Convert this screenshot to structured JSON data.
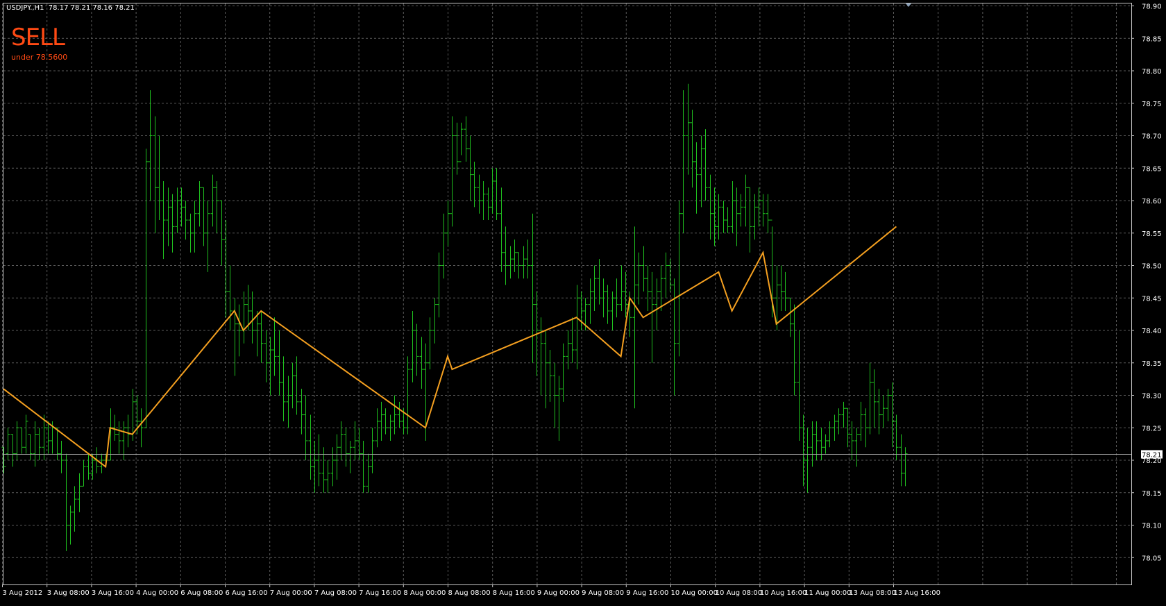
{
  "header": {
    "symbol_info": "USDJPY.,H1  78.17 78.21 78.16 78.21"
  },
  "signal": {
    "label": "SELL",
    "sublabel": "under 78.5600",
    "color": "#ff4a14"
  },
  "colors": {
    "background": "#000000",
    "grid": "#5a5a5a",
    "frame": "#c8c8c8",
    "bars": "#1fc21f",
    "zigzag": "#f5a020",
    "price_line": "#a0a0a0",
    "axis_text": "#ffffff",
    "current_price_bg": "#ffffff",
    "current_price_text": "#000000"
  },
  "chart_data": {
    "type": "ohlc",
    "timeframe": "H1",
    "symbol": "USDJPY.",
    "ylim": [
      78.0,
      78.9
    ],
    "y_ticks": [
      "78.90",
      "78.85",
      "78.80",
      "78.75",
      "78.70",
      "78.65",
      "78.60",
      "78.55",
      "78.50",
      "78.45",
      "78.40",
      "78.35",
      "78.30",
      "78.25",
      "78.20",
      "78.15",
      "78.10",
      "78.05"
    ],
    "x_ticks": [
      "3 Aug 2012",
      "3 Aug 08:00",
      "3 Aug 16:00",
      "4 Aug 00:00",
      "6 Aug 08:00",
      "6 Aug 16:00",
      "7 Aug 00:00",
      "7 Aug 08:00",
      "7 Aug 16:00",
      "8 Aug 00:00",
      "8 Aug 08:00",
      "8 Aug 16:00",
      "9 Aug 00:00",
      "9 Aug 08:00",
      "9 Aug 16:00",
      "10 Aug 00:00",
      "10 Aug 08:00",
      "10 Aug 16:00",
      "11 Aug 00:00",
      "13 Aug 08:00",
      "13 Aug 16:00"
    ],
    "current_price": "78.21",
    "zigzag": [
      {
        "bar": 0,
        "price": 78.31
      },
      {
        "bar": 23,
        "price": 78.19
      },
      {
        "bar": 24,
        "price": 78.25
      },
      {
        "bar": 29,
        "price": 78.24
      },
      {
        "bar": 52,
        "price": 78.43
      },
      {
        "bar": 54,
        "price": 78.4
      },
      {
        "bar": 58,
        "price": 78.43
      },
      {
        "bar": 95,
        "price": 78.25
      },
      {
        "bar": 100,
        "price": 78.36
      },
      {
        "bar": 101,
        "price": 78.34
      },
      {
        "bar": 129,
        "price": 78.42
      },
      {
        "bar": 139,
        "price": 78.36
      },
      {
        "bar": 141,
        "price": 78.45
      },
      {
        "bar": 144,
        "price": 78.42
      },
      {
        "bar": 161,
        "price": 78.49
      },
      {
        "bar": 164,
        "price": 78.43
      },
      {
        "bar": 171,
        "price": 78.52
      },
      {
        "bar": 174,
        "price": 78.41
      },
      {
        "bar": 201,
        "price": 78.56
      }
    ],
    "bars": [
      [
        78.22,
        78.18,
        78.22,
        78.19
      ],
      [
        78.25,
        78.2,
        78.21,
        78.24
      ],
      [
        78.24,
        78.19,
        78.24,
        78.21
      ],
      [
        78.26,
        78.2,
        78.21,
        78.25
      ],
      [
        78.25,
        78.21,
        78.25,
        78.22
      ],
      [
        78.27,
        78.21,
        78.22,
        78.26
      ],
      [
        78.24,
        78.2,
        78.24,
        78.21
      ],
      [
        78.26,
        78.19,
        78.21,
        78.24
      ],
      [
        78.25,
        78.2,
        78.24,
        78.22
      ],
      [
        78.27,
        78.2,
        78.22,
        78.25
      ],
      [
        78.26,
        78.21,
        78.25,
        78.23
      ],
      [
        78.26,
        78.21,
        78.23,
        78.25
      ],
      [
        78.25,
        78.2,
        78.25,
        78.21
      ],
      [
        78.23,
        78.18,
        78.21,
        78.2
      ],
      [
        78.21,
        78.06,
        78.2,
        78.1
      ],
      [
        78.13,
        78.07,
        78.1,
        78.12
      ],
      [
        78.16,
        78.09,
        78.12,
        78.14
      ],
      [
        78.18,
        78.12,
        78.14,
        78.16
      ],
      [
        78.2,
        78.16,
        78.16,
        78.19
      ],
      [
        78.21,
        78.17,
        78.19,
        78.18
      ],
      [
        78.21,
        78.17,
        78.18,
        78.2
      ],
      [
        78.22,
        78.18,
        78.2,
        78.19
      ],
      [
        78.21,
        78.18,
        78.19,
        78.2
      ],
      [
        78.21,
        78.19,
        78.2,
        78.2
      ],
      [
        78.28,
        78.2,
        78.2,
        78.25
      ],
      [
        78.27,
        78.23,
        78.25,
        78.24
      ],
      [
        78.26,
        78.21,
        78.24,
        78.23
      ],
      [
        78.26,
        78.2,
        78.23,
        78.25
      ],
      [
        78.27,
        78.22,
        78.25,
        78.24
      ],
      [
        78.31,
        78.23,
        78.24,
        78.29
      ],
      [
        78.3,
        78.24,
        78.29,
        78.26
      ],
      [
        78.28,
        78.22,
        78.26,
        78.25
      ],
      [
        78.68,
        78.25,
        78.25,
        78.66
      ],
      [
        78.77,
        78.6,
        78.66,
        78.7
      ],
      [
        78.73,
        78.55,
        78.7,
        78.62
      ],
      [
        78.7,
        78.57,
        78.62,
        78.6
      ],
      [
        78.63,
        78.51,
        78.6,
        78.57
      ],
      [
        78.62,
        78.53,
        78.57,
        78.59
      ],
      [
        78.61,
        78.52,
        78.59,
        78.56
      ],
      [
        78.62,
        78.55,
        78.56,
        78.6
      ],
      [
        78.62,
        78.56,
        78.6,
        78.59
      ],
      [
        78.6,
        78.54,
        78.59,
        78.57
      ],
      [
        78.58,
        78.52,
        78.57,
        78.55
      ],
      [
        78.6,
        78.52,
        78.55,
        78.58
      ],
      [
        78.63,
        78.56,
        78.58,
        78.62
      ],
      [
        78.62,
        78.53,
        78.62,
        78.55
      ],
      [
        78.6,
        78.49,
        78.55,
        78.58
      ],
      [
        78.64,
        78.56,
        78.58,
        78.62
      ],
      [
        78.63,
        78.55,
        78.62,
        78.6
      ],
      [
        78.6,
        78.5,
        78.6,
        78.54
      ],
      [
        78.57,
        78.42,
        78.54,
        78.46
      ],
      [
        78.5,
        78.4,
        78.46,
        78.43
      ],
      [
        78.45,
        78.33,
        78.43,
        78.41
      ],
      [
        78.44,
        78.36,
        78.41,
        78.4
      ],
      [
        78.46,
        78.38,
        78.4,
        78.44
      ],
      [
        78.47,
        78.4,
        78.44,
        78.43
      ],
      [
        78.46,
        78.38,
        78.43,
        78.4
      ],
      [
        78.43,
        78.36,
        78.4,
        78.41
      ],
      [
        78.43,
        78.35,
        78.41,
        78.38
      ],
      [
        78.4,
        78.32,
        78.38,
        78.35
      ],
      [
        78.39,
        78.3,
        78.35,
        78.37
      ],
      [
        78.42,
        78.33,
        78.37,
        78.36
      ],
      [
        78.4,
        78.3,
        78.36,
        78.32
      ],
      [
        78.36,
        78.26,
        78.32,
        78.29
      ],
      [
        78.33,
        78.25,
        78.29,
        78.3
      ],
      [
        78.35,
        78.28,
        78.3,
        78.33
      ],
      [
        78.36,
        78.27,
        78.33,
        78.29
      ],
      [
        78.31,
        78.24,
        78.29,
        78.27
      ],
      [
        78.3,
        78.2,
        78.27,
        78.23
      ],
      [
        78.27,
        78.17,
        78.23,
        78.19
      ],
      [
        78.23,
        78.15,
        78.19,
        78.2
      ],
      [
        78.24,
        78.16,
        78.2,
        78.18
      ],
      [
        78.22,
        78.15,
        78.18,
        78.17
      ],
      [
        78.2,
        78.15,
        78.17,
        78.18
      ],
      [
        78.22,
        78.16,
        78.18,
        78.2
      ],
      [
        78.24,
        78.17,
        78.2,
        78.22
      ],
      [
        78.26,
        78.2,
        78.22,
        78.24
      ],
      [
        78.25,
        78.19,
        78.24,
        78.21
      ],
      [
        78.23,
        78.18,
        78.21,
        78.22
      ],
      [
        78.26,
        78.2,
        78.22,
        78.23
      ],
      [
        78.25,
        78.2,
        78.23,
        78.21
      ],
      [
        78.23,
        78.15,
        78.21,
        78.16
      ],
      [
        78.21,
        78.15,
        78.16,
        78.19
      ],
      [
        78.25,
        78.18,
        78.19,
        78.23
      ],
      [
        78.28,
        78.22,
        78.23,
        78.26
      ],
      [
        78.29,
        78.23,
        78.26,
        78.27
      ],
      [
        78.28,
        78.24,
        78.27,
        78.25
      ],
      [
        78.27,
        78.23,
        78.25,
        78.26
      ],
      [
        78.3,
        78.24,
        78.26,
        78.27
      ],
      [
        78.29,
        78.25,
        78.27,
        78.26
      ],
      [
        78.28,
        78.24,
        78.26,
        78.25
      ],
      [
        78.36,
        78.24,
        78.25,
        78.34
      ],
      [
        78.43,
        78.32,
        78.34,
        78.4
      ],
      [
        78.41,
        78.33,
        78.4,
        78.36
      ],
      [
        78.39,
        78.31,
        78.36,
        78.34
      ],
      [
        78.38,
        78.23,
        78.34,
        78.35
      ],
      [
        78.42,
        78.34,
        78.35,
        78.4
      ],
      [
        78.45,
        78.38,
        78.4,
        78.44
      ],
      [
        78.52,
        78.42,
        78.44,
        78.5
      ],
      [
        78.58,
        78.48,
        78.5,
        78.55
      ],
      [
        78.6,
        78.53,
        78.55,
        78.58
      ],
      [
        78.73,
        78.56,
        78.58,
        78.7
      ],
      [
        78.72,
        78.64,
        78.7,
        78.66
      ],
      [
        78.72,
        78.67,
        78.66,
        78.71
      ],
      [
        78.73,
        78.66,
        78.71,
        78.68
      ],
      [
        78.7,
        78.6,
        78.68,
        78.64
      ],
      [
        78.66,
        78.59,
        78.64,
        78.62
      ],
      [
        78.64,
        78.58,
        78.62,
        78.6
      ],
      [
        78.63,
        78.57,
        78.6,
        78.61
      ],
      [
        78.62,
        78.57,
        78.61,
        78.59
      ],
      [
        78.65,
        78.58,
        78.59,
        78.63
      ],
      [
        78.65,
        78.57,
        78.63,
        78.58
      ],
      [
        78.62,
        78.49,
        78.58,
        78.52
      ],
      [
        78.56,
        78.47,
        78.52,
        78.5
      ],
      [
        78.53,
        78.48,
        78.5,
        78.51
      ],
      [
        78.54,
        78.49,
        78.51,
        78.52
      ],
      [
        78.52,
        78.48,
        78.52,
        78.5
      ],
      [
        78.53,
        78.48,
        78.5,
        78.51
      ],
      [
        78.54,
        78.48,
        78.51,
        78.5
      ],
      [
        78.58,
        78.35,
        78.5,
        78.44
      ],
      [
        78.46,
        78.33,
        78.44,
        78.4
      ],
      [
        78.42,
        78.3,
        78.4,
        78.38
      ],
      [
        78.4,
        78.28,
        78.38,
        78.35
      ],
      [
        78.37,
        78.29,
        78.35,
        78.33
      ],
      [
        78.35,
        78.25,
        78.33,
        78.3
      ],
      [
        78.33,
        78.23,
        78.3,
        78.31
      ],
      [
        78.38,
        78.29,
        78.31,
        78.36
      ],
      [
        78.4,
        78.34,
        78.36,
        78.38
      ],
      [
        78.42,
        78.35,
        78.38,
        78.37
      ],
      [
        78.47,
        78.34,
        78.37,
        78.45
      ],
      [
        78.46,
        78.4,
        78.45,
        78.43
      ],
      [
        78.45,
        78.4,
        78.43,
        78.44
      ],
      [
        78.48,
        78.41,
        78.44,
        78.46
      ],
      [
        78.5,
        78.43,
        78.46,
        78.48
      ],
      [
        78.51,
        78.44,
        78.48,
        78.45
      ],
      [
        78.48,
        78.42,
        78.45,
        78.46
      ],
      [
        78.47,
        78.41,
        78.46,
        78.43
      ],
      [
        78.46,
        78.4,
        78.43,
        78.45
      ],
      [
        78.48,
        78.42,
        78.45,
        78.44
      ],
      [
        78.5,
        78.43,
        78.44,
        78.46
      ],
      [
        78.49,
        78.42,
        78.46,
        78.44
      ],
      [
        78.46,
        78.39,
        78.44,
        78.42
      ],
      [
        78.56,
        78.28,
        78.42,
        78.47
      ],
      [
        78.52,
        78.44,
        78.47,
        78.5
      ],
      [
        78.53,
        78.46,
        78.5,
        78.48
      ],
      [
        78.5,
        78.43,
        78.48,
        78.46
      ],
      [
        78.49,
        78.35,
        78.46,
        78.44
      ],
      [
        78.48,
        78.4,
        78.44,
        78.46
      ],
      [
        78.5,
        78.43,
        78.46,
        78.48
      ],
      [
        78.52,
        78.45,
        78.48,
        78.5
      ],
      [
        78.51,
        78.46,
        78.5,
        78.47
      ],
      [
        78.48,
        78.3,
        78.47,
        78.38
      ],
      [
        78.6,
        78.36,
        78.38,
        78.58
      ],
      [
        78.77,
        78.55,
        78.58,
        78.7
      ],
      [
        78.78,
        78.64,
        78.7,
        78.72
      ],
      [
        78.74,
        78.62,
        78.72,
        78.66
      ],
      [
        78.69,
        78.58,
        78.66,
        78.64
      ],
      [
        78.7,
        78.59,
        78.64,
        78.68
      ],
      [
        78.71,
        78.6,
        78.68,
        78.62
      ],
      [
        78.64,
        78.54,
        78.62,
        78.58
      ],
      [
        78.62,
        78.53,
        78.58,
        78.56
      ],
      [
        78.61,
        78.54,
        78.56,
        78.59
      ],
      [
        78.6,
        78.55,
        78.59,
        78.57
      ],
      [
        78.59,
        78.55,
        78.57,
        78.56
      ],
      [
        78.63,
        78.55,
        78.56,
        78.6
      ],
      [
        78.62,
        78.53,
        78.6,
        78.58
      ],
      [
        78.61,
        78.56,
        78.58,
        78.59
      ],
      [
        78.64,
        78.56,
        78.59,
        78.62
      ],
      [
        78.62,
        78.52,
        78.62,
        78.56
      ],
      [
        78.61,
        78.54,
        78.56,
        78.59
      ],
      [
        78.62,
        78.56,
        78.59,
        78.6
      ],
      [
        78.61,
        78.56,
        78.6,
        78.58
      ],
      [
        78.61,
        78.55,
        78.58,
        78.57
      ],
      [
        78.56,
        78.42,
        78.57,
        78.45
      ],
      [
        78.5,
        78.4,
        78.45,
        78.47
      ],
      [
        78.5,
        78.43,
        78.47,
        78.46
      ],
      [
        78.49,
        78.43,
        78.46,
        78.45
      ],
      [
        78.45,
        78.39,
        78.45,
        78.41
      ],
      [
        78.44,
        78.3,
        78.41,
        78.32
      ],
      [
        78.4,
        78.23,
        78.32,
        78.25
      ],
      [
        78.27,
        78.16,
        78.25,
        78.2
      ],
      [
        78.25,
        78.15,
        78.2,
        78.22
      ],
      [
        78.26,
        78.19,
        78.22,
        78.24
      ],
      [
        78.26,
        78.2,
        78.24,
        78.23
      ],
      [
        78.25,
        78.2,
        78.23,
        78.22
      ],
      [
        78.24,
        78.21,
        78.22,
        78.23
      ],
      [
        78.26,
        78.22,
        78.23,
        78.25
      ],
      [
        78.27,
        78.23,
        78.25,
        78.26
      ],
      [
        78.28,
        78.24,
        78.26,
        78.27
      ],
      [
        78.29,
        78.25,
        78.27,
        78.28
      ],
      [
        78.28,
        78.22,
        78.28,
        78.24
      ],
      [
        78.26,
        78.2,
        78.24,
        78.23
      ],
      [
        78.25,
        78.19,
        78.23,
        78.24
      ],
      [
        78.29,
        78.23,
        78.24,
        78.27
      ],
      [
        78.28,
        78.22,
        78.27,
        78.25
      ],
      [
        78.35,
        78.24,
        78.25,
        78.32
      ],
      [
        78.34,
        78.25,
        78.32,
        78.29
      ],
      [
        78.31,
        78.24,
        78.29,
        78.27
      ],
      [
        78.3,
        78.25,
        78.27,
        78.28
      ],
      [
        78.31,
        78.26,
        78.28,
        78.3
      ],
      [
        78.32,
        78.22,
        78.3,
        78.26
      ],
      [
        78.27,
        78.2,
        78.26,
        78.22
      ],
      [
        78.24,
        78.16,
        78.22,
        78.18
      ],
      [
        78.22,
        78.16,
        78.18,
        78.21
      ]
    ]
  }
}
